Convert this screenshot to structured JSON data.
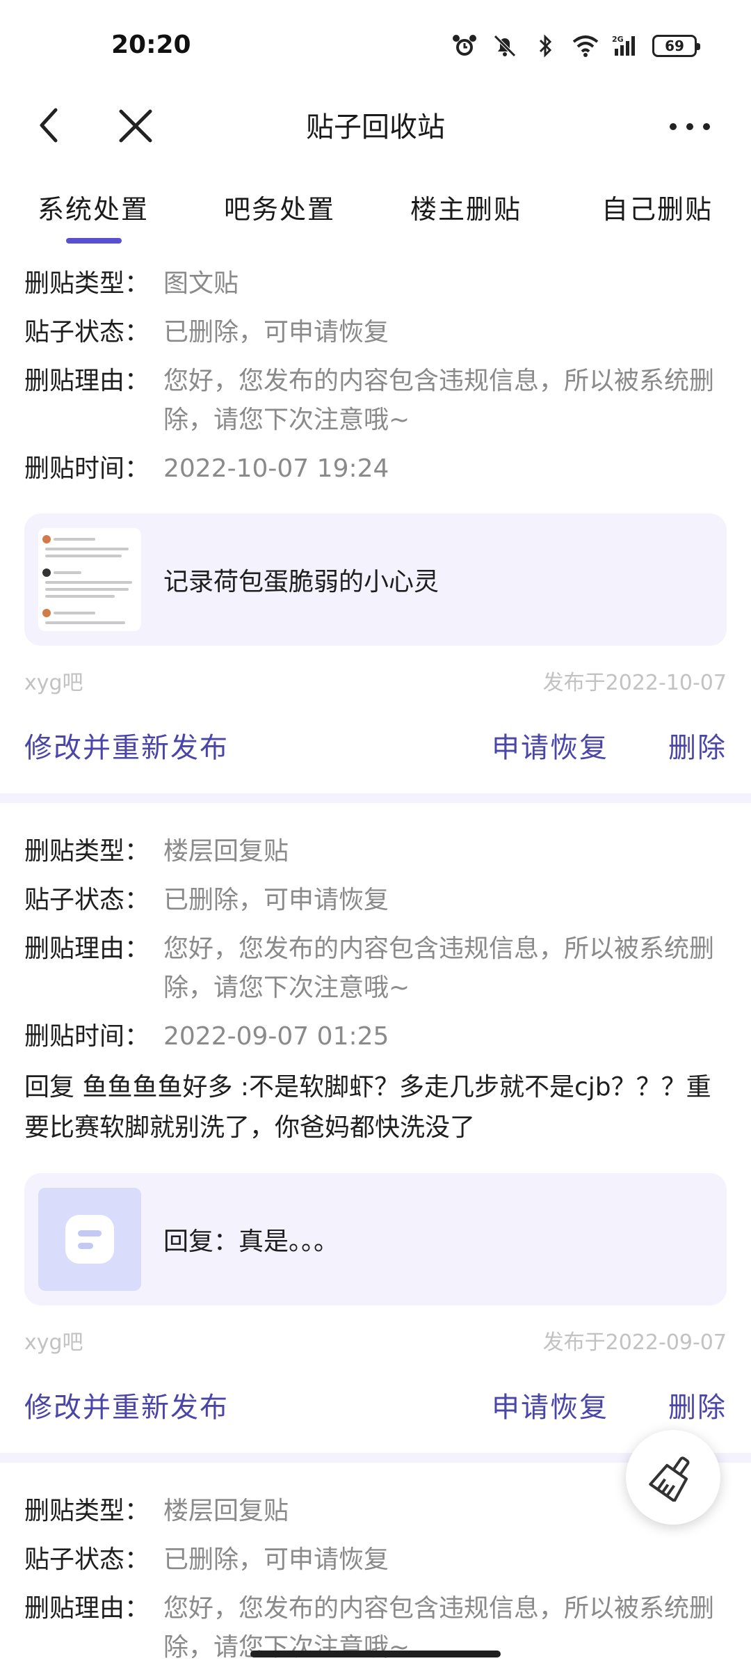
{
  "status_bar": {
    "time": "20:20",
    "battery": "69"
  },
  "header": {
    "title": "贴子回收站"
  },
  "tabs": [
    "系统处置",
    "吧务处置",
    "楼主删贴",
    "自己删贴"
  ],
  "labels": {
    "type": "删贴类型：",
    "status": "贴子状态：",
    "reason": "删贴理由：",
    "time": "删贴时间："
  },
  "posts": [
    {
      "type": "图文贴",
      "status": "已删除，可申请恢复",
      "reason": "您好，您发布的内容包含违规信息，所以被系统删除，请您下次注意哦~",
      "time": "2022-10-07 19:24",
      "post_title": "记录荷包蛋脆弱的小心灵",
      "forum": "xyg吧",
      "published": "发布于2022-10-07",
      "edit": "修改并重新发布",
      "restore": "申请恢复",
      "delete": "删除"
    },
    {
      "type": "楼层回复贴",
      "status": "已删除，可申请恢复",
      "reason": "您好，您发布的内容包含违规信息，所以被系统删除，请您下次注意哦~",
      "time": "2022-09-07 01:25",
      "reply": "回复 鱼鱼鱼鱼好多 :不是软脚虾？多走几步就不是cjb？？？重要比赛软脚就别洗了，你爸妈都快洗没了",
      "post_title": "回复：真是。。。",
      "forum": "xyg吧",
      "published": "发布于2022-09-07",
      "edit": "修改并重新发布",
      "restore": "申请恢复",
      "delete": "删除"
    },
    {
      "type": "楼层回复贴",
      "status": "已删除，可申请恢复",
      "reason": "您好，您发布的内容包含违规信息，所以被系统删除，请您下次注意哦~"
    }
  ],
  "colors": {
    "accent": "#5a4fd0",
    "action": "#4a45a8",
    "box": "#f3f2fd",
    "muted": "#8a8a8a"
  },
  "icons": [
    "alarm-icon",
    "mute-icon",
    "bluetooth-icon",
    "wifi-icon",
    "signal-icon",
    "battery-icon",
    "back-icon",
    "close-icon",
    "more-icon",
    "broom-icon"
  ]
}
